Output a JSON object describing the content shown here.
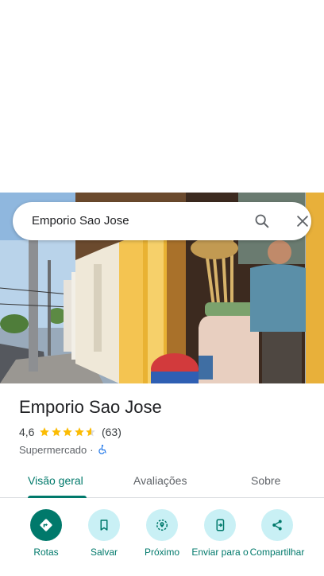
{
  "search": {
    "query": "Emporio Sao Jose"
  },
  "place": {
    "title": "Emporio Sao Jose",
    "rating": "4,6",
    "stars": 4.6,
    "reviews": "(63)",
    "category": "Supermercado",
    "separator": "·"
  },
  "tabs": [
    {
      "label": "Visão geral",
      "active": true
    },
    {
      "label": "Avaliações",
      "active": false
    },
    {
      "label": "Sobre",
      "active": false
    }
  ],
  "actions": [
    {
      "label": "Rotas",
      "icon": "directions-icon"
    },
    {
      "label": "Salvar",
      "icon": "bookmark-icon"
    },
    {
      "label": "Próximo",
      "icon": "nearby-icon"
    },
    {
      "label": "Enviar para o",
      "icon": "send-to-phone-icon"
    },
    {
      "label": "Compartilhar",
      "icon": "share-icon"
    }
  ],
  "colors": {
    "accent": "#00796b",
    "star": "#fbbc04",
    "chip": "#c9f0f5"
  }
}
